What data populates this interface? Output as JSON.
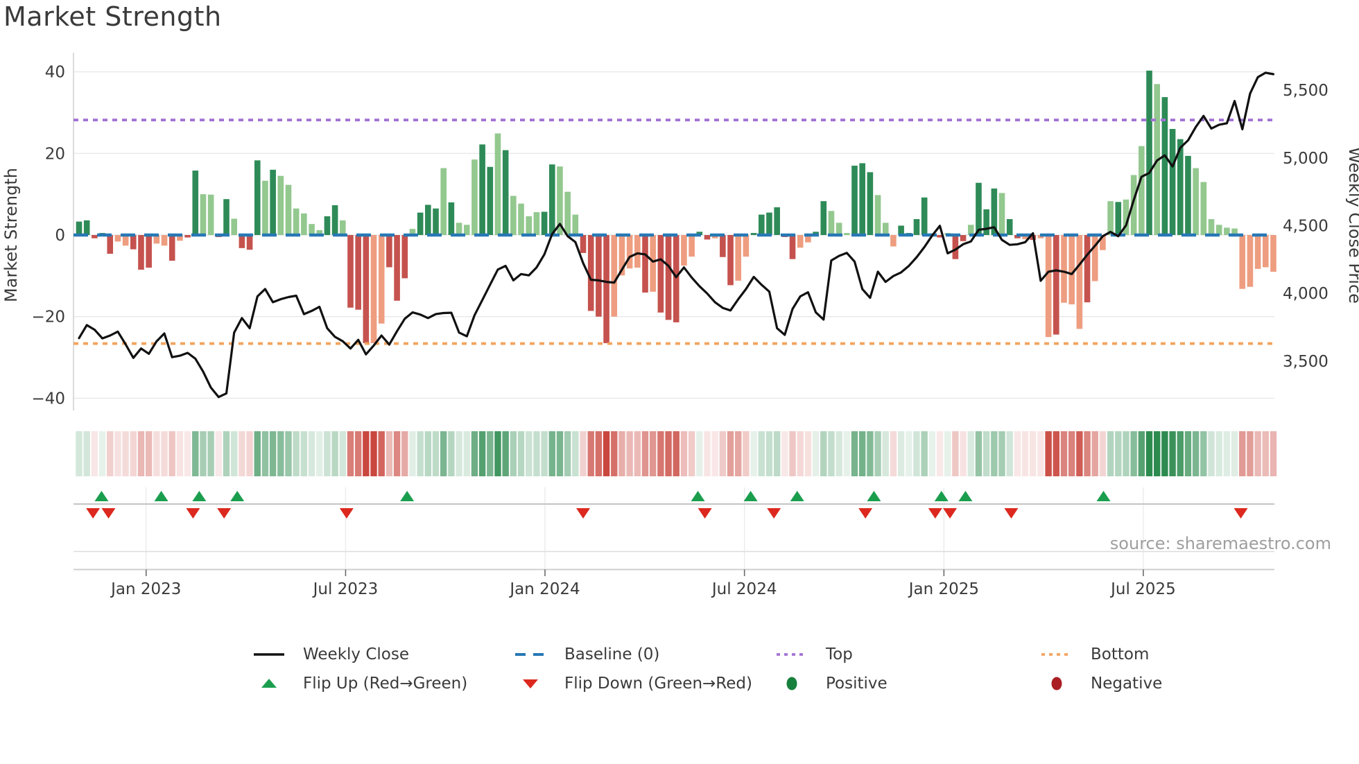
{
  "title": "Market Strength",
  "source": "source: sharemaestro.com",
  "axes": {
    "left": {
      "label": "Market Strength",
      "tick_values": [
        40,
        20,
        0,
        -20,
        -40
      ]
    },
    "right": {
      "label": "Weekly Close Price",
      "tick_values": [
        5500,
        5000,
        4500,
        4000,
        3500
      ],
      "tick_labels": [
        "5,500",
        "5,000",
        "4,500",
        "4,000",
        "3,500"
      ]
    },
    "x": {
      "tick_labels": [
        "Jan 2023",
        "Jul 2023",
        "Jan 2024",
        "Jul 2024",
        "Jan 2025",
        "Jul 2025"
      ],
      "tick_weeks": [
        8.65,
        34.37,
        60.08,
        85.8,
        111.52,
        137.23
      ]
    }
  },
  "colors": {
    "dark_green": "#2e8b57",
    "light_green": "#93c88f",
    "dark_red": "#c5524e",
    "salmon": "#ee9d80",
    "heat_green": [
      45,
      139,
      79
    ],
    "heat_red": [
      198,
      62,
      53
    ],
    "weekly_close": "#111111",
    "baseline": "#2778b5",
    "top": "#a273d4",
    "bottom": "#f3a45f",
    "flip_up": "#1a9e4e",
    "flip_down": "#dc281e",
    "positive_dot": "#17803d",
    "negative_dot": "#aa1f24",
    "grid": "#e8e8ea",
    "spine": "#cfcfcf",
    "tick_text": "#3a3a3a",
    "source_text": "#9e9e9e"
  },
  "legend": {
    "row1": [
      {
        "label": "Weekly Close",
        "type": "line-solid"
      },
      {
        "label": "Baseline (0)",
        "type": "line-dashed"
      },
      {
        "label": "Top",
        "type": "line-dotted-purple"
      },
      {
        "label": "Bottom",
        "type": "line-dotted-orange"
      }
    ],
    "row2": [
      {
        "label": "Flip Up (Red→Green)",
        "type": "triangle-up"
      },
      {
        "label": "Flip Down (Green→Red)",
        "type": "triangle-down"
      },
      {
        "label": "Positive",
        "type": "dot-green"
      },
      {
        "label": "Negative",
        "type": "dot-red"
      }
    ]
  },
  "chart_data": {
    "type": "bar+line",
    "weeks": 155,
    "x_range_note": "weekly data, Nov 2022 to Oct 2025",
    "ylim_left": [
      -43,
      44.7
    ],
    "ylim_right": [
      3180,
      5770
    ],
    "baseline": 0,
    "top_level": 28.2,
    "bottom_level": -26.6,
    "strength_values": [
      3.3,
      3.6,
      -0.8,
      0.5,
      -4.6,
      -1.6,
      -2.6,
      -3.5,
      -8.5,
      -8.0,
      -2.1,
      -2.6,
      -6.3,
      -1.4,
      -0.6,
      15.8,
      10.0,
      9.9,
      -0.5,
      8.8,
      4.0,
      -3.2,
      -3.6,
      18.3,
      13.3,
      16.0,
      14.5,
      12.3,
      6.5,
      5.3,
      2.7,
      1.2,
      4.6,
      7.3,
      3.6,
      -17.8,
      -18.3,
      -26.5,
      -26.5,
      -21.7,
      -7.9,
      -16.1,
      -10.6,
      1.5,
      5.5,
      7.4,
      6.5,
      16.4,
      8.0,
      3.0,
      2.5,
      18.5,
      22.2,
      16.7,
      24.9,
      20.8,
      9.6,
      7.7,
      4.6,
      5.6,
      5.7,
      17.3,
      16.8,
      10.6,
      5.0,
      -4.4,
      -18.6,
      -20.0,
      -26.5,
      -20.0,
      -9.9,
      -8.2,
      -8.0,
      -14.1,
      -13.9,
      -19.0,
      -20.8,
      -21.4,
      -7.5,
      -5.3,
      0.8,
      -1.1,
      -0.8,
      -5.4,
      -12.3,
      -11.2,
      -5.3,
      0.5,
      5.0,
      5.5,
      6.8,
      -0.5,
      -5.9,
      -3.1,
      -1.8,
      0.8,
      8.3,
      5.9,
      3.0,
      0.5,
      17.0,
      17.6,
      15.4,
      9.8,
      3.0,
      -2.8,
      2.3,
      0.5,
      3.9,
      9.2,
      0.4,
      -0.6,
      0.5,
      -5.9,
      -1.5,
      2.5,
      12.8,
      6.3,
      11.4,
      10.3,
      3.9,
      -0.8,
      -1.0,
      -1.2,
      -0.8,
      -25.0,
      -24.4,
      -16.6,
      -17.0,
      -23.0,
      -16.5,
      -11.3,
      -3.7,
      8.3,
      8.1,
      8.7,
      14.7,
      21.8,
      40.3,
      37.0,
      33.8,
      26.0,
      23.5,
      19.4,
      16.4,
      13.0,
      3.9,
      2.5,
      1.8,
      1.6,
      -13.2,
      -12.7,
      -8.3,
      -7.9,
      -9.0
    ],
    "strength_shades": "dddddlldddlldlddllddldddldllllllddldddlldddldddldlllddldllllddlllddddlllldldddllddlddllddddddllddllldddlllddddddlddldddlddldlldllldllldllldlddddlllllllllllddlld",
    "weekly_close": [
      3670,
      3766,
      3732,
      3668,
      3689,
      3718,
      3625,
      3524,
      3593,
      3554,
      3647,
      3704,
      3529,
      3540,
      3561,
      3518,
      3422,
      3305,
      3235,
      3262,
      3711,
      3818,
      3743,
      3978,
      4032,
      3935,
      3957,
      3973,
      3983,
      3847,
      3871,
      3901,
      3743,
      3679,
      3647,
      3593,
      3657,
      3550,
      3615,
      3689,
      3622,
      3721,
      3813,
      3860,
      3844,
      3818,
      3847,
      3855,
      3857,
      3711,
      3683,
      3839,
      3951,
      4064,
      4176,
      4203,
      4096,
      4143,
      4133,
      4192,
      4288,
      4438,
      4513,
      4422,
      4379,
      4224,
      4101,
      4096,
      4085,
      4080,
      4176,
      4269,
      4296,
      4288,
      4235,
      4252,
      4203,
      4120,
      4192,
      4117,
      4053,
      3999,
      3935,
      3893,
      3874,
      3957,
      4032,
      4122,
      4064,
      4013,
      3743,
      3694,
      3885,
      3978,
      4008,
      3860,
      3807,
      4243,
      4277,
      4299,
      4235,
      4032,
      3967,
      4160,
      4085,
      4128,
      4155,
      4203,
      4267,
      4342,
      4427,
      4499,
      4296,
      4323,
      4363,
      4384,
      4470,
      4477,
      4488,
      4395,
      4358,
      4363,
      4378,
      4444,
      4093,
      4160,
      4170,
      4160,
      4143,
      4213,
      4285,
      4351,
      4422,
      4454,
      4422,
      4502,
      4690,
      4861,
      4889,
      4981,
      5019,
      4937,
      5075,
      5130,
      5228,
      5310,
      5217,
      5245,
      5256,
      5420,
      5212,
      5475,
      5596,
      5629,
      5618
    ],
    "flip_up_weeks": [
      2.9,
      10.6,
      15.5,
      20.4,
      42.3,
      79.8,
      86.6,
      92.6,
      102.5,
      111.2,
      114.3,
      132.1
    ],
    "flip_down_weeks": [
      1.8,
      3.8,
      14.7,
      18.7,
      34.5,
      65.0,
      80.7,
      89.6,
      101.4,
      110.4,
      112.3,
      120.2,
      149.8
    ]
  }
}
